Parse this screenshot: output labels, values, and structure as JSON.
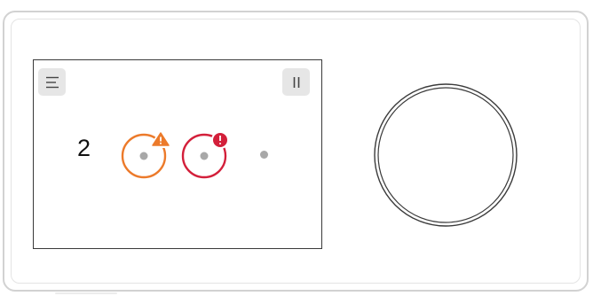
{
  "header": {
    "menu_icon": "hamburger-menu-icon",
    "pause_icon": "pause-icon"
  },
  "status": {
    "count": "2",
    "items": [
      {
        "state": "warning",
        "icon": "warning-triangle-icon",
        "color": "#ec7a2a"
      },
      {
        "state": "error",
        "icon": "error-exclamation-icon",
        "color": "#d31f3a"
      },
      {
        "state": "idle",
        "icon": "idle-dot-icon",
        "color": "#a8a8a8"
      }
    ]
  },
  "control": {
    "knob_icon": "rotary-knob-icon"
  },
  "colors": {
    "screen_border": "#3a3a3a",
    "button_bg": "#e6e6e6",
    "device_border": "#d2d2d2"
  }
}
